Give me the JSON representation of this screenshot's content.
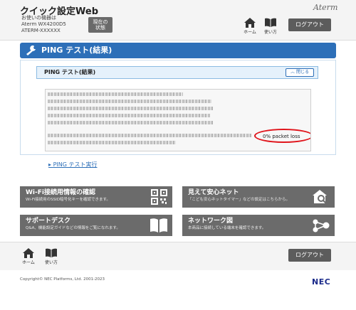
{
  "header": {
    "app_title": "クイック設定Web",
    "device_caption": "お使いの機器は",
    "device_model": "Aterm WX4200D5",
    "device_name": "ATERM-XXXXXX",
    "status_label": "現在の\n状態",
    "brand": "Aterm",
    "home_label": "ホーム",
    "guide_label": "使い方",
    "logout_label": "ログアウト"
  },
  "page": {
    "title": "PING テスト(結果)",
    "section_title": "PING テスト(結果)",
    "close_label": "閉じる",
    "result_highlight": "0% packet loss",
    "ping_link": "PING テスト実行"
  },
  "tiles": [
    {
      "title": "Wi-Fi接続用情報の確認",
      "desc": "Wi-Fi接続用のSSID暗号化キーを確認できます。",
      "icon": "qr-code-icon"
    },
    {
      "title": "見えて安心ネット",
      "desc": "「こども安心ネットタイマー」などの設定はこちらから。",
      "icon": "house-search-icon"
    },
    {
      "title": "サポートデスク",
      "desc": "Q&A、機能設定ガイドなどの情報をご覧になれます。",
      "icon": "open-book-icon"
    },
    {
      "title": "ネットワーク図",
      "desc": "本商品に接続している端末を確認できます。",
      "icon": "network-nodes-icon"
    }
  ],
  "footer": {
    "home_label": "ホーム",
    "guide_label": "使い方",
    "logout_label": "ログアウト",
    "copyright": "Copyright© NEC Platforms, Ltd. 2001-2023",
    "logo": "NEC"
  },
  "colors": {
    "accent_blue": "#2d6fb8",
    "tile_gray": "#6b6b6b",
    "highlight_red": "#e0141b"
  }
}
